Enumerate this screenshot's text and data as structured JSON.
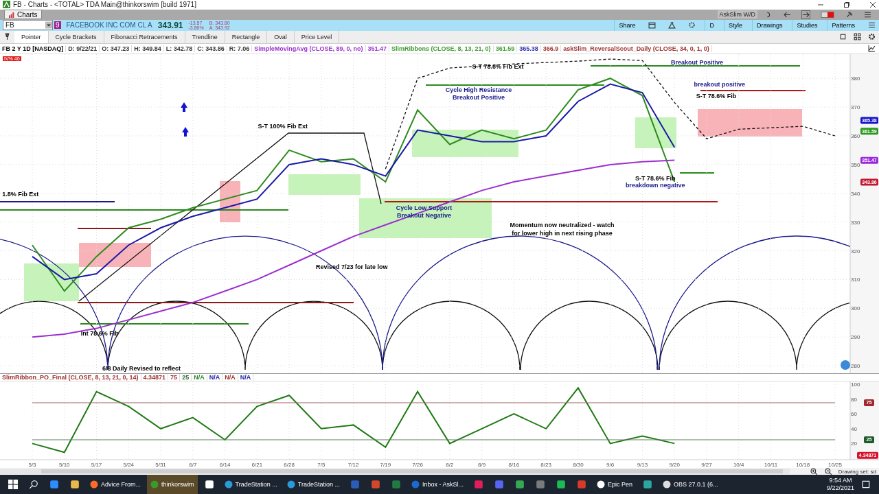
{
  "window": {
    "title": "FB - Charts - <TOTAL> TDA Main@thinkorswim [build 1971]"
  },
  "tabs": [
    {
      "label": "Charts",
      "selected": true
    }
  ],
  "layout_name": "AskSlim W/D",
  "symbol": {
    "value": "FB",
    "link_group": "9",
    "company": "FACEBOOK INC COM CL A",
    "last": "343.91",
    "change": "-13.57",
    "change_pct": "-3.80%",
    "bid": "B: 343.80",
    "ask": "A: 343.92"
  },
  "chart_menu": [
    "Share",
    "D",
    "Style",
    "Drawings",
    "Studies",
    "Patterns"
  ],
  "drawing_tools": [
    {
      "label": "Pointer",
      "selected": true
    },
    {
      "label": "Cycle Brackets",
      "selected": false
    },
    {
      "label": "Fibonacci Retracements",
      "selected": false
    },
    {
      "label": "Trendline",
      "selected": false
    },
    {
      "label": "Rectangle",
      "selected": false
    },
    {
      "label": "Oval",
      "selected": false
    },
    {
      "label": "Price Level",
      "selected": false
    }
  ],
  "study_info": [
    {
      "text": "FB 2 Y 1D [NASDAQ]",
      "color": "#000000"
    },
    {
      "text": "D: 9/22/21",
      "color": "#333333"
    },
    {
      "text": "O: 347.23",
      "color": "#333333"
    },
    {
      "text": "H: 349.84",
      "color": "#333333"
    },
    {
      "text": "L: 342.78",
      "color": "#333333"
    },
    {
      "text": "C: 343.86",
      "color": "#333333"
    },
    {
      "text": "R: 7.06",
      "color": "#333333"
    },
    {
      "text": "SimpleMovingAvg (CLOSE, 89, 0, no)",
      "color": "#9b30d0"
    },
    {
      "text": "351.47",
      "color": "#9b30d0"
    },
    {
      "text": "SlimRibbons (CLOSE, 8, 13, 21, 0)",
      "color": "#3c9a2e"
    },
    {
      "text": "361.59",
      "color": "#3c9a2e"
    },
    {
      "text": "365.38",
      "color": "#2a2ab0"
    },
    {
      "text": "366.9",
      "color": "#a03030"
    },
    {
      "text": "askSlim_ReversalScout_Daily (CLOSE, 34, 0, 1, 0)",
      "color": "#a03030"
    }
  ],
  "iv_badge": "IV% 40",
  "price_chart": {
    "chart_data": {
      "type": "line",
      "grid": true,
      "ylim": [
        277.4,
        388.4
      ],
      "series": [
        {
          "color": "#2e8b1e",
          "values": [
            322,
            306,
            318,
            328,
            331,
            335,
            338,
            341,
            355,
            351,
            352,
            344,
            369,
            357,
            362,
            359,
            362,
            376,
            380,
            374,
            344,
            null,
            null,
            null,
            null,
            null
          ]
        },
        {
          "color": "#1a1aa8",
          "values": [
            318,
            310,
            312,
            322,
            328,
            332,
            335,
            338,
            350,
            352,
            350,
            346,
            362,
            360,
            358,
            358,
            360,
            372,
            378,
            375,
            356,
            null,
            null,
            null,
            null,
            null
          ]
        },
        {
          "color": "#9b30d0",
          "values": [
            290,
            291,
            293,
            296,
            299,
            302,
            306,
            310,
            315,
            320,
            325,
            329,
            333,
            337,
            341,
            344,
            346,
            348,
            350,
            351,
            351.5,
            null,
            null,
            null,
            null,
            null
          ]
        },
        {
          "color": "#111111",
          "line_style": "dashed",
          "values": [
            null,
            null,
            null,
            null,
            null,
            null,
            null,
            null,
            null,
            null,
            null,
            348.5,
            380,
            383.6,
            384.3,
            385,
            385.5,
            386,
            386.7,
            386.2,
            371.6,
            359,
            362.3,
            362.8,
            363.3,
            360
          ]
        }
      ],
      "yticks": [
        280,
        290,
        300,
        310,
        320,
        330,
        340,
        350,
        360,
        370,
        380
      ]
    },
    "notes": [
      {
        "text": "Breakout Positive",
        "color": "#1a1a8c"
      },
      {
        "text": "S-T 78.6% Fib Ext",
        "color": "#000000"
      },
      {
        "text": "Cycle High Resistance",
        "color": "#1a1a8c"
      },
      {
        "text": "Breakout Positive",
        "color": "#1a1a8c"
      },
      {
        "text": "breakout positive",
        "color": "#1a1a8c"
      },
      {
        "text": "S-T 78.6% Fib",
        "color": "#000000"
      },
      {
        "text": "S-T 100% Fib Ext",
        "color": "#000000"
      },
      {
        "text": "1.8% Fib Ext",
        "color": "#000000"
      },
      {
        "text": "S-T 78.6% Fib",
        "color": "#000000"
      },
      {
        "text": "breakdown negative",
        "color": "#1a1a8c"
      },
      {
        "text": "Cycle Low Support",
        "color": "#1a1a8c"
      },
      {
        "text": "Breakout Negative",
        "color": "#1a1a8c"
      },
      {
        "text": "Momentum now neutralized - watch",
        "color": "#000000"
      },
      {
        "text": "for lower high in next rising phase",
        "color": "#000000"
      },
      {
        "text": "Revised 7/23 for late low",
        "color": "#000000"
      },
      {
        "text": "Int 78.6% Fib",
        "color": "#000000"
      },
      {
        "text": "6/8 Daily Revised to reflect",
        "color": "#000000"
      }
    ],
    "price_labels": [
      {
        "text": "365.38",
        "color": "#1414c8"
      },
      {
        "text": "361.59",
        "color": "#2a9a1e"
      },
      {
        "text": "351.47",
        "color": "#9a28e0"
      },
      {
        "text": "343.86",
        "color": "#c0182e"
      }
    ]
  },
  "lower_study": {
    "info": [
      {
        "text": "SlimRibbon_PO_Final (CLOSE, 8, 13, 21, 0, 14)",
        "color": "#a03030"
      },
      {
        "text": "4.34871",
        "color": "#a03030"
      },
      {
        "text": "75",
        "color": "#a03030"
      },
      {
        "text": "25",
        "color": "#2a6a2a"
      },
      {
        "text": "N/A",
        "color": "#2a8a2a"
      },
      {
        "text": "N/A",
        "color": "#1a1aa8"
      },
      {
        "text": "N/A",
        "color": "#a03030"
      },
      {
        "text": "N/A",
        "color": "#1a1aa8"
      }
    ],
    "chart_data": {
      "type": "line",
      "grid": true,
      "ylim": [
        -1.9,
        103.7
      ],
      "categories": [
        "5/3",
        "5/10",
        "5/17",
        "5/24",
        "5/31",
        "6/7",
        "6/14",
        "6/21",
        "6/28",
        "7/5",
        "7/12",
        "7/19",
        "7/26",
        "8/2",
        "8/9",
        "8/16",
        "8/23",
        "8/30",
        "9/6",
        "9/13",
        "9/20",
        "9/27",
        "10/4",
        "10/11",
        "10/18",
        "10/25"
      ],
      "series": [
        {
          "color": "#1f7a14",
          "values": [
            20,
            8,
            90,
            70,
            40,
            55,
            25,
            70,
            85,
            40,
            45,
            15,
            90,
            20,
            40,
            60,
            40,
            95,
            20,
            30,
            20,
            null,
            null,
            null,
            null,
            null
          ]
        },
        {
          "color": "#a06060",
          "values": [
            75,
            75,
            75,
            75,
            75,
            75,
            75,
            75,
            75,
            75,
            75,
            75,
            75,
            75,
            75,
            75,
            75,
            75,
            75,
            75,
            75,
            75,
            75,
            75,
            75,
            75
          ]
        },
        {
          "color": "#608060",
          "values": [
            25,
            25,
            25,
            25,
            25,
            25,
            25,
            25,
            25,
            25,
            25,
            25,
            25,
            25,
            25,
            25,
            25,
            25,
            25,
            25,
            25,
            25,
            25,
            25,
            25,
            25
          ]
        }
      ],
      "yticks": [
        20,
        40,
        60,
        80,
        100
      ]
    },
    "levels": [
      {
        "text": "75",
        "color": "#a02830"
      },
      {
        "text": "25",
        "color": "#1f5a2a"
      },
      {
        "text": "4.34871",
        "color": "#d8102a"
      }
    ]
  },
  "status": {
    "drawing_set": "Drawing set: sd"
  },
  "taskbar": {
    "apps": [
      {
        "kind": "icon",
        "color": "#2d8cff"
      },
      {
        "kind": "icon",
        "color": "#e8b84a"
      },
      {
        "kind": "labeled",
        "label": "Advice From...",
        "color": "#ff6a2a",
        "selected": false
      },
      {
        "kind": "labeled",
        "label": "thinkorswim",
        "color": "#3a9a2a",
        "selected": true
      },
      {
        "kind": "icon",
        "color": "#ffffff"
      },
      {
        "kind": "labeled",
        "label": "TradeStation ...",
        "color": "#2a9ad8",
        "selected": false
      },
      {
        "kind": "labeled",
        "label": "TradeStation ...",
        "color": "#2a9ad8",
        "selected": false
      },
      {
        "kind": "icon",
        "color": "#2b5cb8"
      },
      {
        "kind": "icon",
        "color": "#d2472a"
      },
      {
        "kind": "icon",
        "color": "#1f7a44"
      },
      {
        "kind": "labeled",
        "label": "Inbox - AskSl...",
        "color": "#1a6ad0",
        "selected": false
      },
      {
        "kind": "icon",
        "color": "#e01e5a"
      },
      {
        "kind": "icon",
        "color": "#5865f2"
      },
      {
        "kind": "icon",
        "color": "#34a853"
      },
      {
        "kind": "icon",
        "color": "#7a7a7a"
      },
      {
        "kind": "icon",
        "color": "#1db954"
      },
      {
        "kind": "icon",
        "color": "#d83a2a"
      },
      {
        "kind": "labeled",
        "label": "Epic Pen",
        "color": "#ffffff",
        "selected": false
      },
      {
        "kind": "icon",
        "color": "#2aa8a0"
      },
      {
        "kind": "labeled",
        "label": "OBS 27.0.1 (6...",
        "color": "#dddddd",
        "selected": false
      }
    ],
    "time": "9:54 AM",
    "date": "9/22/2021"
  }
}
